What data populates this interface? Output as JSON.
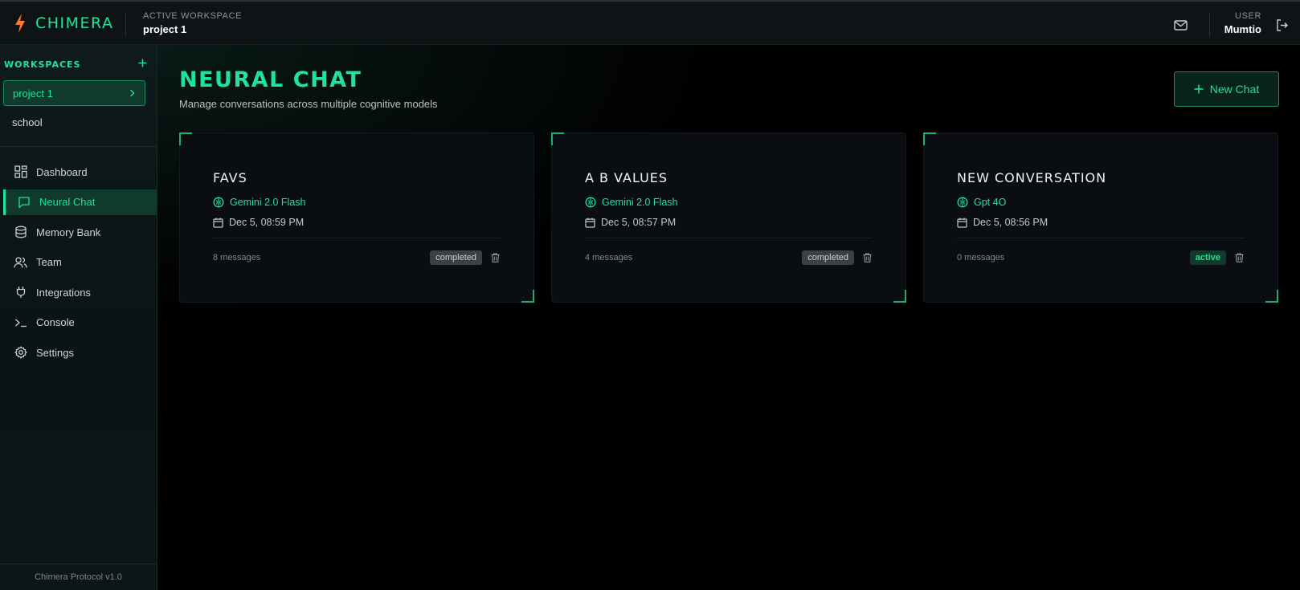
{
  "app": {
    "brand": "CHIMERA",
    "accent_color": "#1ee39a",
    "bolt_color": "#ff7a2f"
  },
  "header": {
    "workspace_caption": "ACTIVE WORKSPACE",
    "workspace_name": "project 1",
    "user_caption": "USER",
    "user_name": "Mumtio",
    "mail_icon": "mail-icon",
    "logout_icon": "logout-icon"
  },
  "sidebar": {
    "workspaces_title": "WORKSPACES",
    "add_icon": "plus-icon",
    "workspaces": [
      {
        "label": "project 1",
        "active": true
      },
      {
        "label": "school",
        "active": false
      }
    ],
    "nav": [
      {
        "label": "Dashboard",
        "icon": "grid-icon"
      },
      {
        "label": "Neural Chat",
        "icon": "message-icon",
        "active": true
      },
      {
        "label": "Memory Bank",
        "icon": "database-icon"
      },
      {
        "label": "Team",
        "icon": "users-icon"
      },
      {
        "label": "Integrations",
        "icon": "plug-icon"
      },
      {
        "label": "Console",
        "icon": "terminal-icon"
      },
      {
        "label": "Settings",
        "icon": "gear-icon"
      }
    ],
    "footer": "Chimera Protocol v1.0"
  },
  "main": {
    "title": "NEURAL CHAT",
    "subtitle": "Manage conversations across multiple cognitive models",
    "new_chat_label": "New Chat",
    "chats": [
      {
        "title": "FAVS",
        "model": "Gemini 2.0 Flash",
        "date": "Dec 5, 08:59 PM",
        "messages": "8 messages",
        "status": "completed"
      },
      {
        "title": "A B VALUES",
        "model": "Gemini 2.0 Flash",
        "date": "Dec 5, 08:57 PM",
        "messages": "4 messages",
        "status": "completed"
      },
      {
        "title": "NEW CONVERSATION",
        "model": "Gpt 4O",
        "date": "Dec 5, 08:56 PM",
        "messages": "0 messages",
        "status": "active"
      }
    ]
  }
}
